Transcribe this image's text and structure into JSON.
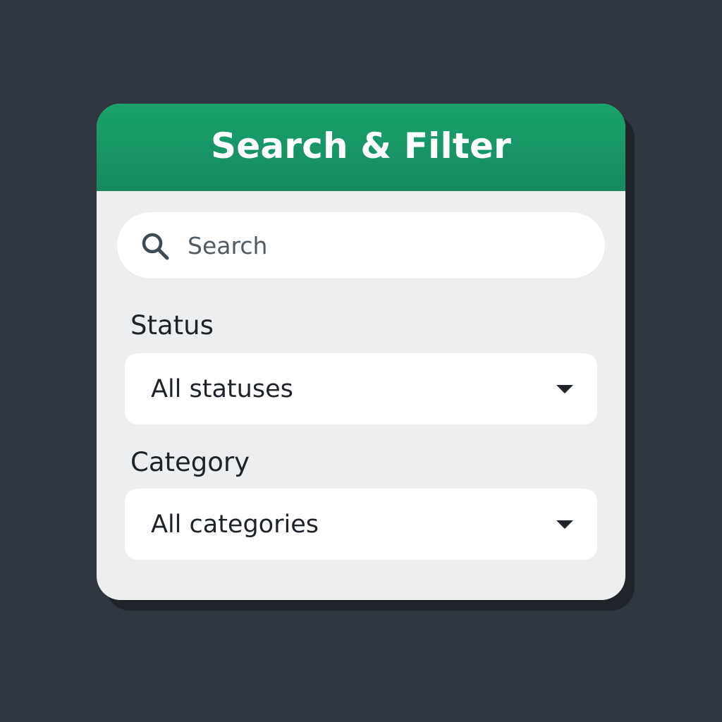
{
  "panel": {
    "title": "Search & Filter"
  },
  "search": {
    "placeholder": "Search",
    "icon": "search-icon"
  },
  "filters": {
    "status": {
      "label": "Status",
      "selected": "All statuses",
      "icon": "chevron-down-icon"
    },
    "category": {
      "label": "Category",
      "selected": "All categories",
      "icon": "chevron-down-icon"
    }
  },
  "colors": {
    "background": "#303741",
    "header": "#1aa36b",
    "panel": "#edeef0",
    "text": "#1d2329"
  }
}
